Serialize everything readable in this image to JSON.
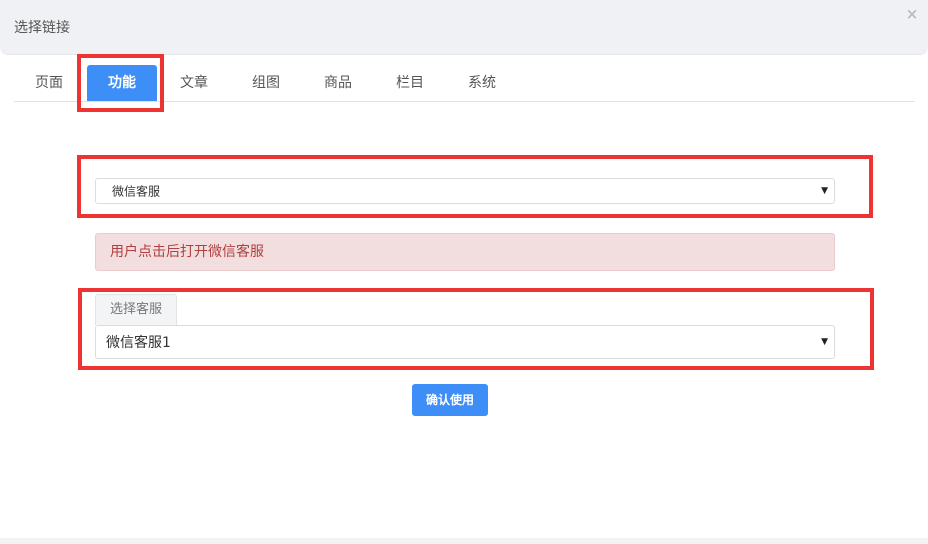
{
  "modal": {
    "title": "选择链接",
    "close_icon": "close-icon",
    "close_glyph": "×"
  },
  "tabs": [
    {
      "label": "页面",
      "active": false
    },
    {
      "label": "功能",
      "active": true
    },
    {
      "label": "文章",
      "active": false
    },
    {
      "label": "组图",
      "active": false
    },
    {
      "label": "商品",
      "active": false
    },
    {
      "label": "栏目",
      "active": false
    },
    {
      "label": "系统",
      "active": false
    }
  ],
  "function_select": {
    "value": "微信客服",
    "caret_icon": "caret-down-icon",
    "caret_glyph": "▼"
  },
  "alert": {
    "text": "用户点击后打开微信客服"
  },
  "service_select": {
    "addon_label": "选择客服",
    "value": "微信客服1",
    "caret_icon": "caret-down-icon",
    "caret_glyph": "▼"
  },
  "confirm_button": {
    "label": "确认使用"
  },
  "colors": {
    "accent": "#3e8ef7",
    "alert_bg": "#f2dede",
    "alert_text": "#b04040",
    "highlight": "#ee3333"
  }
}
